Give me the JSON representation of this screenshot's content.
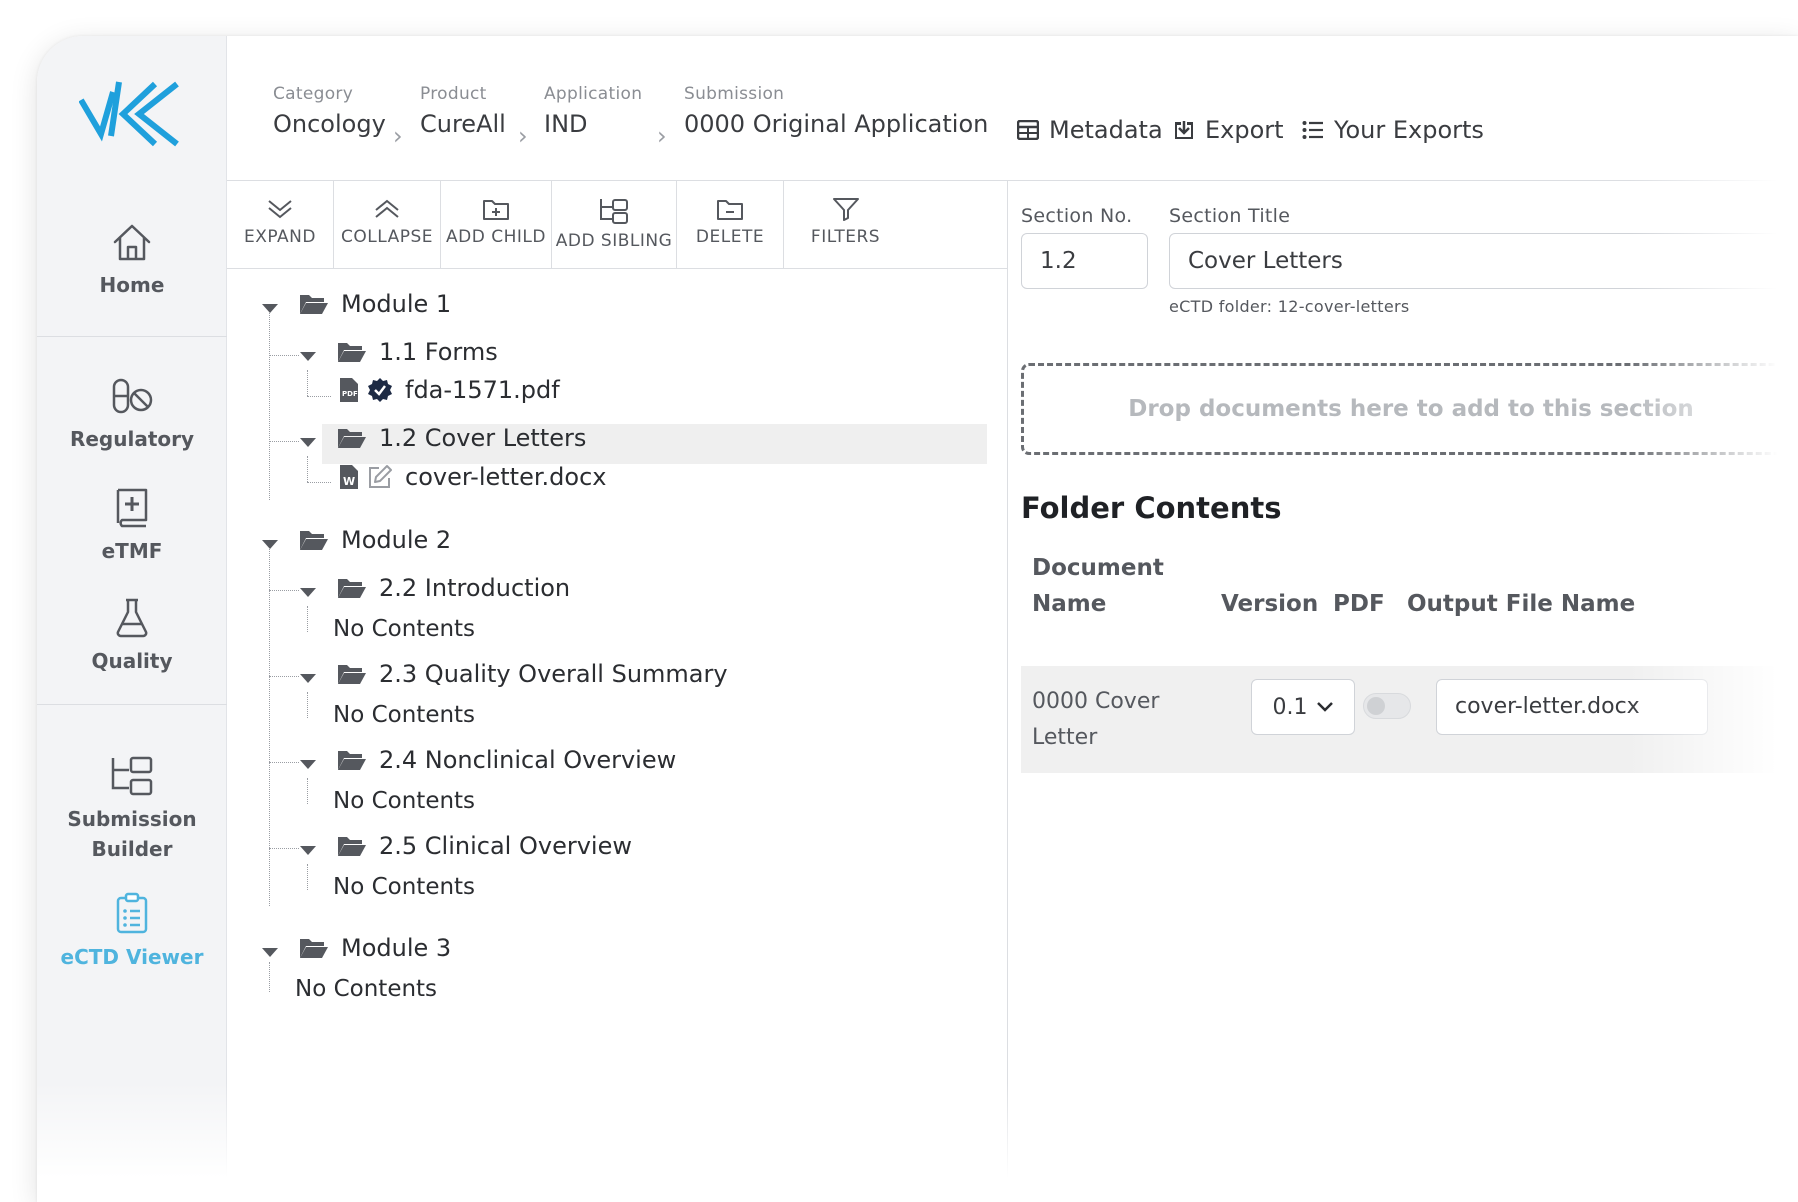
{
  "sidebar": {
    "items": [
      {
        "label": "Home",
        "icon": "home-icon"
      },
      {
        "label": "Regulatory",
        "icon": "pills-icon"
      },
      {
        "label": "eTMF",
        "icon": "medical-book-icon"
      },
      {
        "label": "Quality",
        "icon": "flask-icon"
      },
      {
        "label": "Submission Builder",
        "icon": "folder-tree-icon"
      },
      {
        "label": "eCTD Viewer",
        "icon": "clipboard-list-icon"
      }
    ],
    "active": "eCTD Viewer"
  },
  "breadcrumb": [
    {
      "label": "Category",
      "value": "Oncology"
    },
    {
      "label": "Product",
      "value": "CureAll"
    },
    {
      "label": "Application",
      "value": "IND"
    },
    {
      "label": "Submission",
      "value": "0000 Original Application"
    }
  ],
  "header_actions": {
    "metadata": "Metadata",
    "export": "Export",
    "your_exports": "Your Exports"
  },
  "toolbar": {
    "expand": "EXPAND",
    "collapse": "COLLAPSE",
    "add_child": "ADD CHILD",
    "add_sibling": "ADD SIBLING",
    "delete": "DELETE",
    "filters": "FILTERS"
  },
  "tree": {
    "module1": "Module 1",
    "forms": "1.1 Forms",
    "forms_file": "fda-1571.pdf",
    "cover_letters": "1.2 Cover Letters",
    "cover_file": "cover-letter.docx",
    "module2": "Module 2",
    "intro": "2.2 Introduction",
    "quality_summary": "2.3 Quality Overall Summary",
    "nonclinical": "2.4 Nonclinical Overview",
    "clinical": "2.5 Clinical Overview",
    "module3": "Module 3",
    "no_contents": "No Contents"
  },
  "section": {
    "no_label": "Section No.",
    "no_value": "1.2",
    "title_label": "Section Title",
    "title_value": "Cover Letters",
    "folder_hint": "eCTD folder: 12-cover-letters"
  },
  "dropzone": "Drop documents here to add to this section",
  "folder_contents": {
    "heading": "Folder Contents",
    "columns": {
      "doc_name_1": "Document",
      "doc_name_2": "Name",
      "version": "Version",
      "pdf": "PDF",
      "output": "Output File Name"
    },
    "rows": [
      {
        "name_1": "0000 Cover",
        "name_2": "Letter",
        "version": "0.1",
        "pdf": false,
        "output": "cover-letter.docx"
      }
    ]
  },
  "colors": {
    "accent": "#4fb4de",
    "logo": "#1fa0dc",
    "verified": "#1d2a44"
  }
}
